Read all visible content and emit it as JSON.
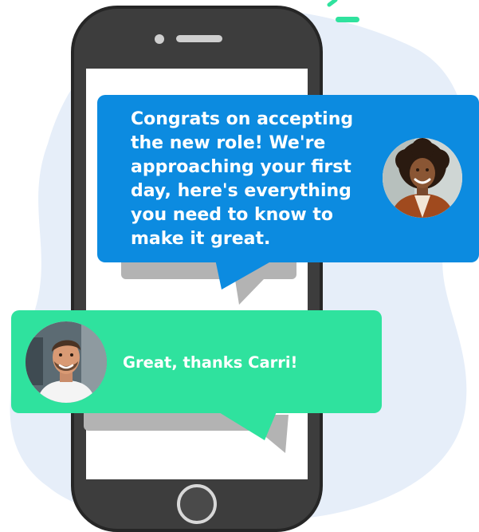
{
  "messages": {
    "incoming": {
      "text": "Congrats on accepting\nthe new role! We're\napproaching your first\nday, here's everything\nyou need to know to\nmake it great.",
      "bubble_color": "#0c8be0"
    },
    "reply": {
      "text": "Great, thanks Carri!",
      "bubble_color": "#2fe29e"
    }
  },
  "avatars": {
    "sender": "woman-avatar",
    "replier": "man-avatar"
  },
  "colors": {
    "background_blob": "#e6eef9",
    "phone_body": "#3d3d3d",
    "bubble_shadow": "#b3b3b3",
    "accent": "#2fe29e"
  }
}
